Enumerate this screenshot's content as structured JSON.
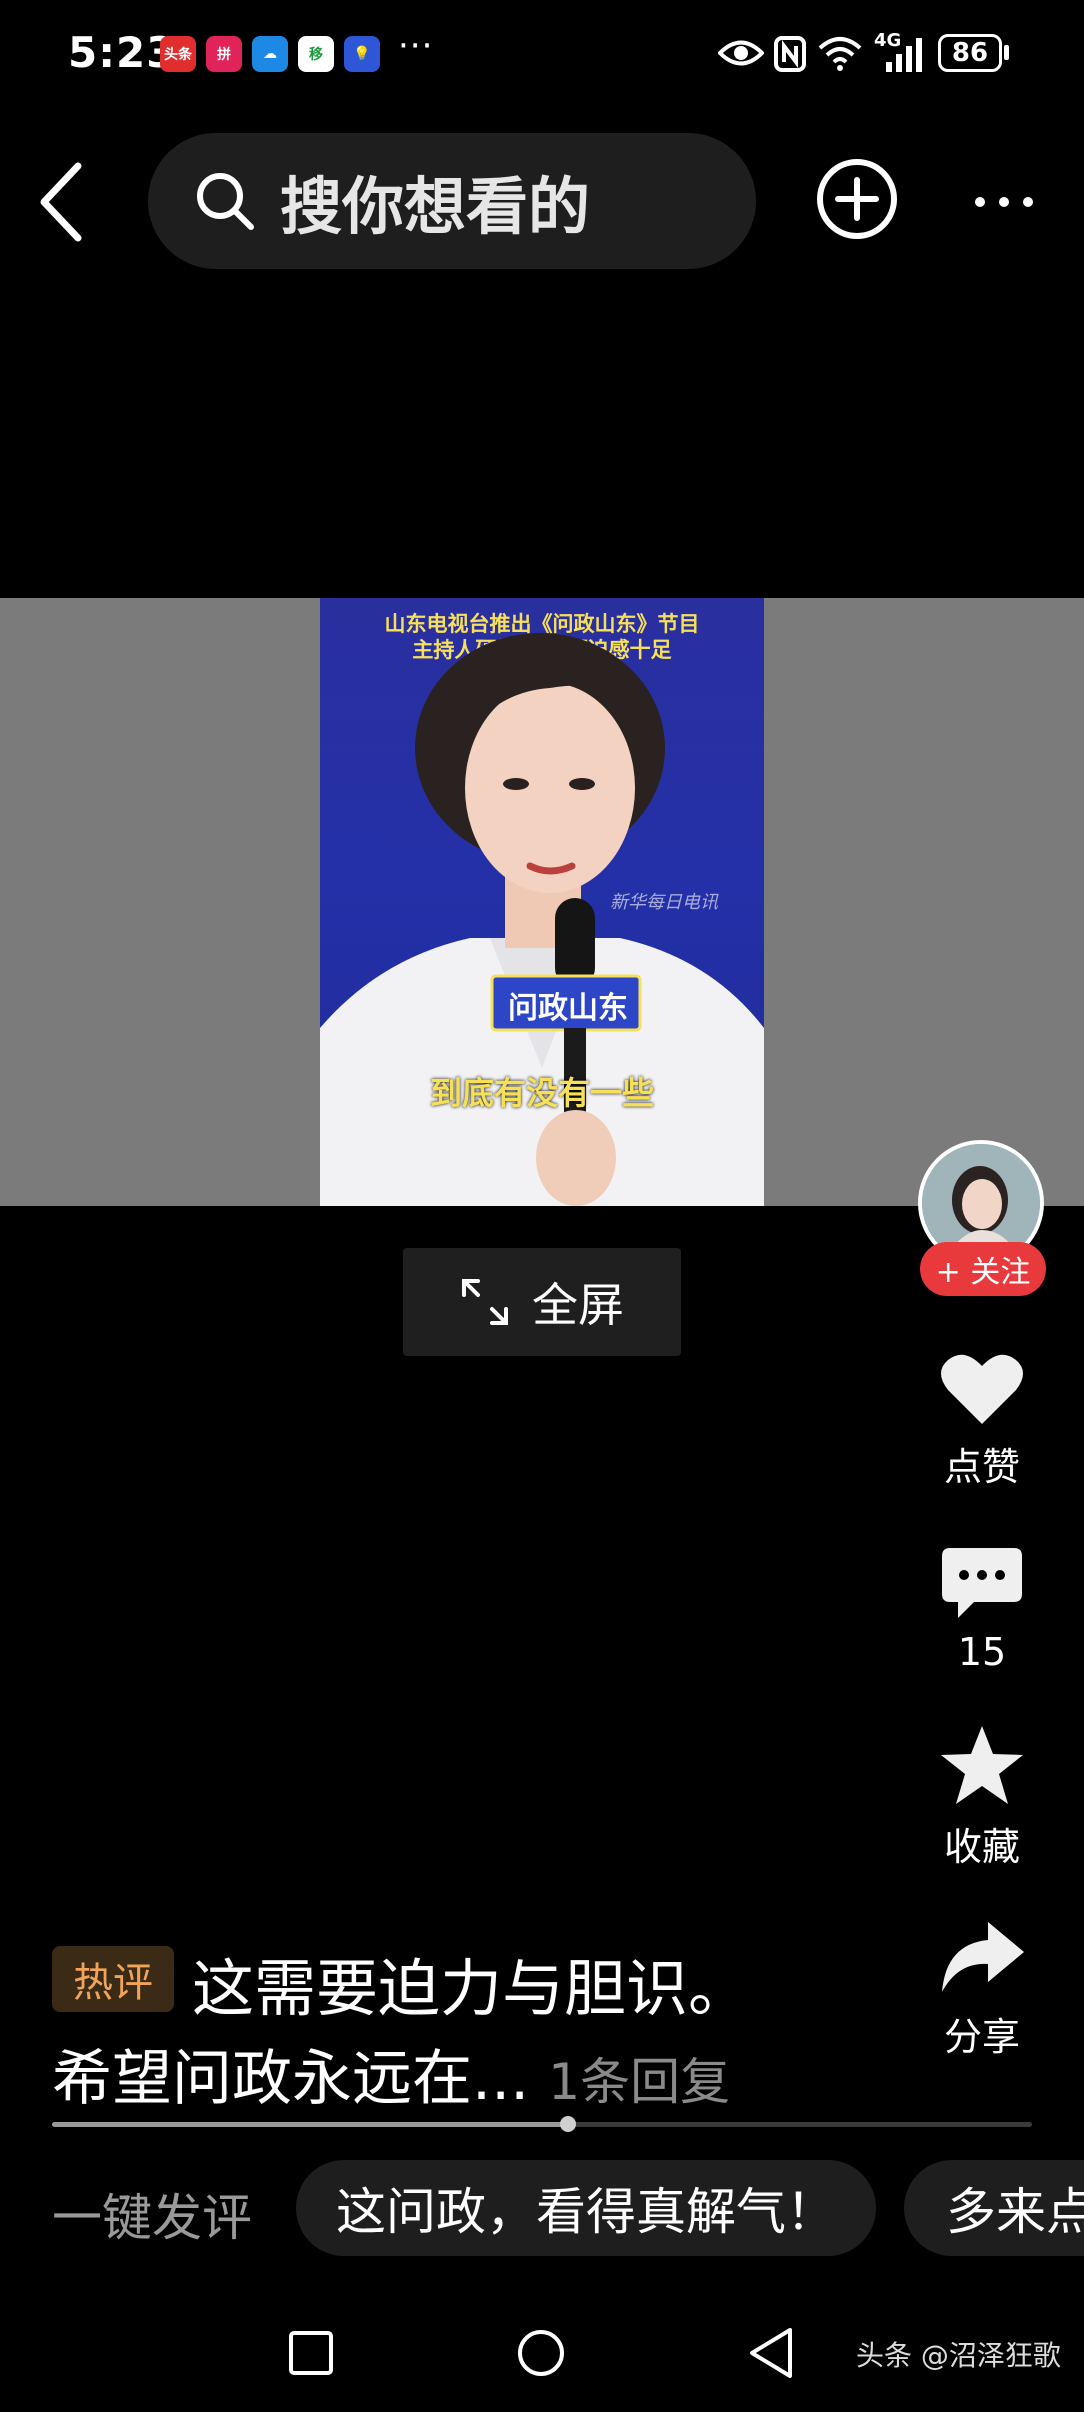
{
  "status_bar": {
    "time": "5:23",
    "app_icons": [
      {
        "name": "toutiao-app-icon",
        "text": "头条",
        "color": "#e02e2e"
      },
      {
        "name": "pinduoduo-app-icon",
        "text": "拼",
        "color": "#e0245a"
      },
      {
        "name": "cloud-app-icon",
        "text": "☁",
        "color": "#1e88e5"
      },
      {
        "name": "mobile-app-icon",
        "text": "移",
        "color": "#ffffff"
      },
      {
        "name": "bulb-app-icon",
        "text": "💡",
        "color": "#2f56d6"
      }
    ],
    "more": "···",
    "network": "4G",
    "battery": "86"
  },
  "top_nav": {
    "search_placeholder": "搜你想看的"
  },
  "video": {
    "caption_line1": "山东电视台推出《问政山东》节目",
    "caption_line2": "主持人硬核提问 压迫感十足",
    "mic_tag": "问政山东",
    "subtitle": "到底有没有一些",
    "watermark": "新华每日电讯",
    "fullscreen_label": "全屏"
  },
  "rail": {
    "follow_label": "+ 关注",
    "like_label": "点赞",
    "comment_count": "15",
    "favorite_label": "收藏",
    "share_label": "分享"
  },
  "comment": {
    "tag": "热评",
    "line1": "这需要迫力与胆识。",
    "line2": "希望问政永远在...",
    "reply_count": "1条回复"
  },
  "progress": {
    "played_fraction": 0.527
  },
  "quick_comment": {
    "label": "一键发评",
    "suggestions": [
      "这问政，看得真解气！",
      "多来点"
    ]
  },
  "source_watermark": "头条 @沼泽狂歌",
  "colors": {
    "accent_red": "#e8393d",
    "tag_orange": "#f0a35a"
  }
}
